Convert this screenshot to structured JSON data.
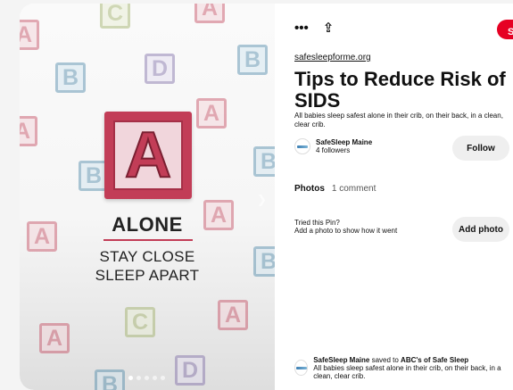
{
  "media": {
    "block_letter": "A",
    "caption_main": "ALONE",
    "caption_line2": "STAY CLOSE",
    "caption_line3": "SLEEP APART",
    "background_blocks": [
      {
        "letter": "A",
        "kind": "a"
      },
      {
        "letter": "C",
        "kind": "c"
      },
      {
        "letter": "A",
        "kind": "a"
      },
      {
        "letter": "B",
        "kind": "b"
      },
      {
        "letter": "D",
        "kind": "d"
      },
      {
        "letter": "B",
        "kind": "b"
      },
      {
        "letter": "A",
        "kind": "a"
      },
      {
        "letter": "A",
        "kind": "a"
      },
      {
        "letter": "B",
        "kind": "b"
      },
      {
        "letter": "B",
        "kind": "b"
      },
      {
        "letter": "A",
        "kind": "a"
      },
      {
        "letter": "A",
        "kind": "a"
      },
      {
        "letter": "B",
        "kind": "b"
      },
      {
        "letter": "C",
        "kind": "c"
      },
      {
        "letter": "A",
        "kind": "a"
      },
      {
        "letter": "A",
        "kind": "a"
      },
      {
        "letter": "B",
        "kind": "b"
      },
      {
        "letter": "D",
        "kind": "d"
      }
    ],
    "carousel_count": 5,
    "carousel_active": 1,
    "next_icon": "chevron-right-icon"
  },
  "toolbar": {
    "more_icon": "•••",
    "share_icon": "⇪",
    "save_label": "Save"
  },
  "pin": {
    "source": "safesleepforme.org",
    "title": "Tips to Reduce Risk of SIDS",
    "description": "All babies sleep safest alone in their crib, on their back, in a clean, clear crib."
  },
  "creator": {
    "name": "SafeSleep Maine",
    "followers": "4 followers",
    "follow_label": "Follow"
  },
  "tabs": {
    "photos": "Photos",
    "comments": "1 comment"
  },
  "tried": {
    "question": "Tried this Pin?",
    "prompt": "Add a photo to show how it went",
    "button": "Add photo"
  },
  "saved": {
    "user": "SafeSleep Maine",
    "action": " saved to ",
    "board": "ABC's of Safe Sleep",
    "text": "All babies sleep safest alone in their crib, on their back, in a clean, clear crib."
  },
  "colors": {
    "save_red": "#e60023",
    "block_red": "#c23d57"
  }
}
